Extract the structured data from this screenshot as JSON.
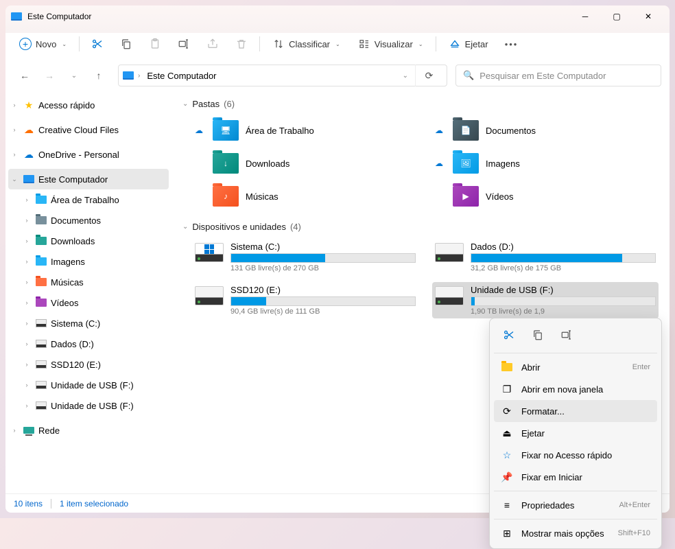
{
  "window": {
    "title": "Este Computador"
  },
  "toolbar": {
    "new": "Novo",
    "sort": "Classificar",
    "view": "Visualizar",
    "eject": "Ejetar"
  },
  "address": {
    "location": "Este Computador"
  },
  "search": {
    "placeholder": "Pesquisar em Este Computador"
  },
  "sidebar": {
    "quick_access": "Acesso rápido",
    "creative_cloud": "Creative Cloud Files",
    "onedrive": "OneDrive - Personal",
    "this_pc": "Este Computador",
    "tree": {
      "desktop": "Área de Trabalho",
      "documents": "Documentos",
      "downloads": "Downloads",
      "images": "Imagens",
      "music": "Músicas",
      "videos": "Vídeos",
      "drive_c": "Sistema (C:)",
      "drive_d": "Dados (D:)",
      "drive_e": "SSD120 (E:)",
      "drive_f": "Unidade de USB (F:)",
      "drive_f2": "Unidade de USB (F:)"
    },
    "network": "Rede"
  },
  "groups": {
    "folders": {
      "title": "Pastas",
      "count": "(6)"
    },
    "devices": {
      "title": "Dispositivos e unidades",
      "count": "(4)"
    }
  },
  "folders": {
    "desktop": "Área de Trabalho",
    "documents": "Documentos",
    "downloads": "Downloads",
    "images": "Imagens",
    "music": "Músicas",
    "videos": "Vídeos"
  },
  "drives": {
    "c": {
      "name": "Sistema (C:)",
      "free": "131 GB livre(s) de 270 GB",
      "fill": 51
    },
    "d": {
      "name": "Dados (D:)",
      "free": "31,2 GB livre(s) de 175 GB",
      "fill": 82
    },
    "e": {
      "name": "SSD120 (E:)",
      "free": "90,4 GB livre(s) de 111 GB",
      "fill": 19
    },
    "f": {
      "name": "Unidade de USB (F:)",
      "free": "1,90 TB livre(s) de 1,9",
      "fill": 2
    }
  },
  "status": {
    "items": "10 itens",
    "selected": "1 item selecionado"
  },
  "ctx": {
    "open": "Abrir",
    "open_short": "Enter",
    "open_new": "Abrir em nova janela",
    "format": "Formatar...",
    "eject": "Ejetar",
    "pin_quick": "Fixar no Acesso rápido",
    "pin_start": "Fixar em Iniciar",
    "properties": "Propriedades",
    "properties_short": "Alt+Enter",
    "more": "Mostrar mais opções",
    "more_short": "Shift+F10"
  }
}
